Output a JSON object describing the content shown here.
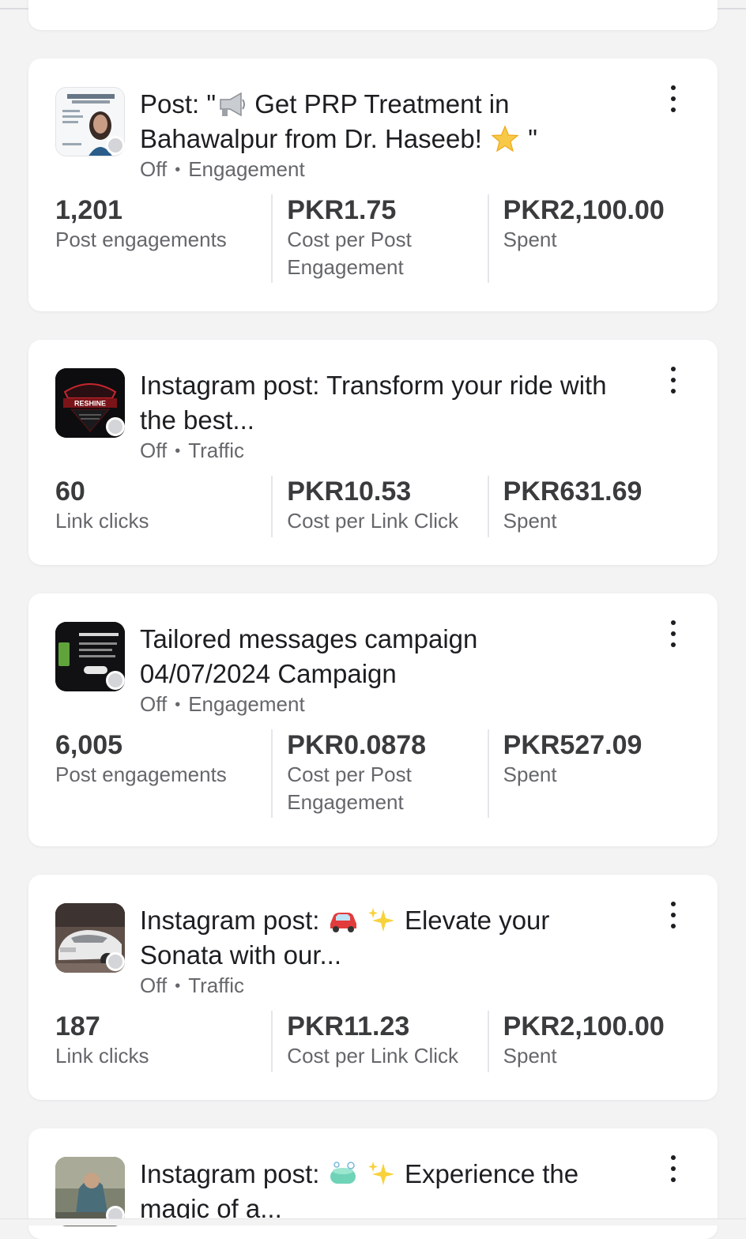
{
  "campaigns": [
    {
      "title": "Post: \" 📢 Get PRP Treatment in Bahawalpur from Dr. Haseeb! 🌟 \"",
      "title_parts": [
        "Post: \"",
        " Get PRP Treatment in Bahawalpur from Dr. Haseeb! ",
        " \""
      ],
      "status": "Off",
      "objective": "Engagement",
      "thumb_icon": "prp-clinic-thumbnail",
      "metrics": [
        {
          "value": "1,201",
          "label": "Post engagements"
        },
        {
          "value": "PKR1.75",
          "label": "Cost per Post Engagement"
        },
        {
          "value": "PKR2,100.00",
          "label": "Spent"
        }
      ]
    },
    {
      "title": "Instagram post: Transform your ride with the best...",
      "status": "Off",
      "objective": "Traffic",
      "thumb_icon": "reshine-logo-thumbnail",
      "thumb_text": "RESHINE",
      "metrics": [
        {
          "value": "60",
          "label": "Link clicks"
        },
        {
          "value": "PKR10.53",
          "label": "Cost per Link Click"
        },
        {
          "value": "PKR631.69",
          "label": "Spent"
        }
      ]
    },
    {
      "title": "Tailored messages campaign 04/07/2024 Campaign",
      "status": "Off",
      "objective": "Engagement",
      "thumb_icon": "shopify-ad-thumbnail",
      "metrics": [
        {
          "value": "6,005",
          "label": "Post engagements"
        },
        {
          "value": "PKR0.0878",
          "label": "Cost per Post Engagement"
        },
        {
          "value": "PKR527.09",
          "label": "Spent"
        }
      ]
    },
    {
      "title": "Instagram post: 🚗 ✨ Elevate your Sonata with our...",
      "title_parts": [
        "Instagram post: ",
        " ",
        " Elevate your Sonata with our..."
      ],
      "status": "Off",
      "objective": "Traffic",
      "thumb_icon": "car-photo-thumbnail",
      "metrics": [
        {
          "value": "187",
          "label": "Link clicks"
        },
        {
          "value": "PKR11.23",
          "label": "Cost per Link Click"
        },
        {
          "value": "PKR2,100.00",
          "label": "Spent"
        }
      ]
    },
    {
      "title": "Instagram post: 🧼 ✨ Experience the magic of a...",
      "title_parts": [
        "Instagram post: ",
        " ",
        " Experience the magic of a..."
      ],
      "thumb_icon": "car-wash-thumbnail"
    }
  ],
  "separator": "•",
  "colors": {
    "background": "#f3f3f4",
    "card": "#ffffff",
    "status_dot": "#d4d5d8",
    "secondary_text": "#65676b"
  }
}
